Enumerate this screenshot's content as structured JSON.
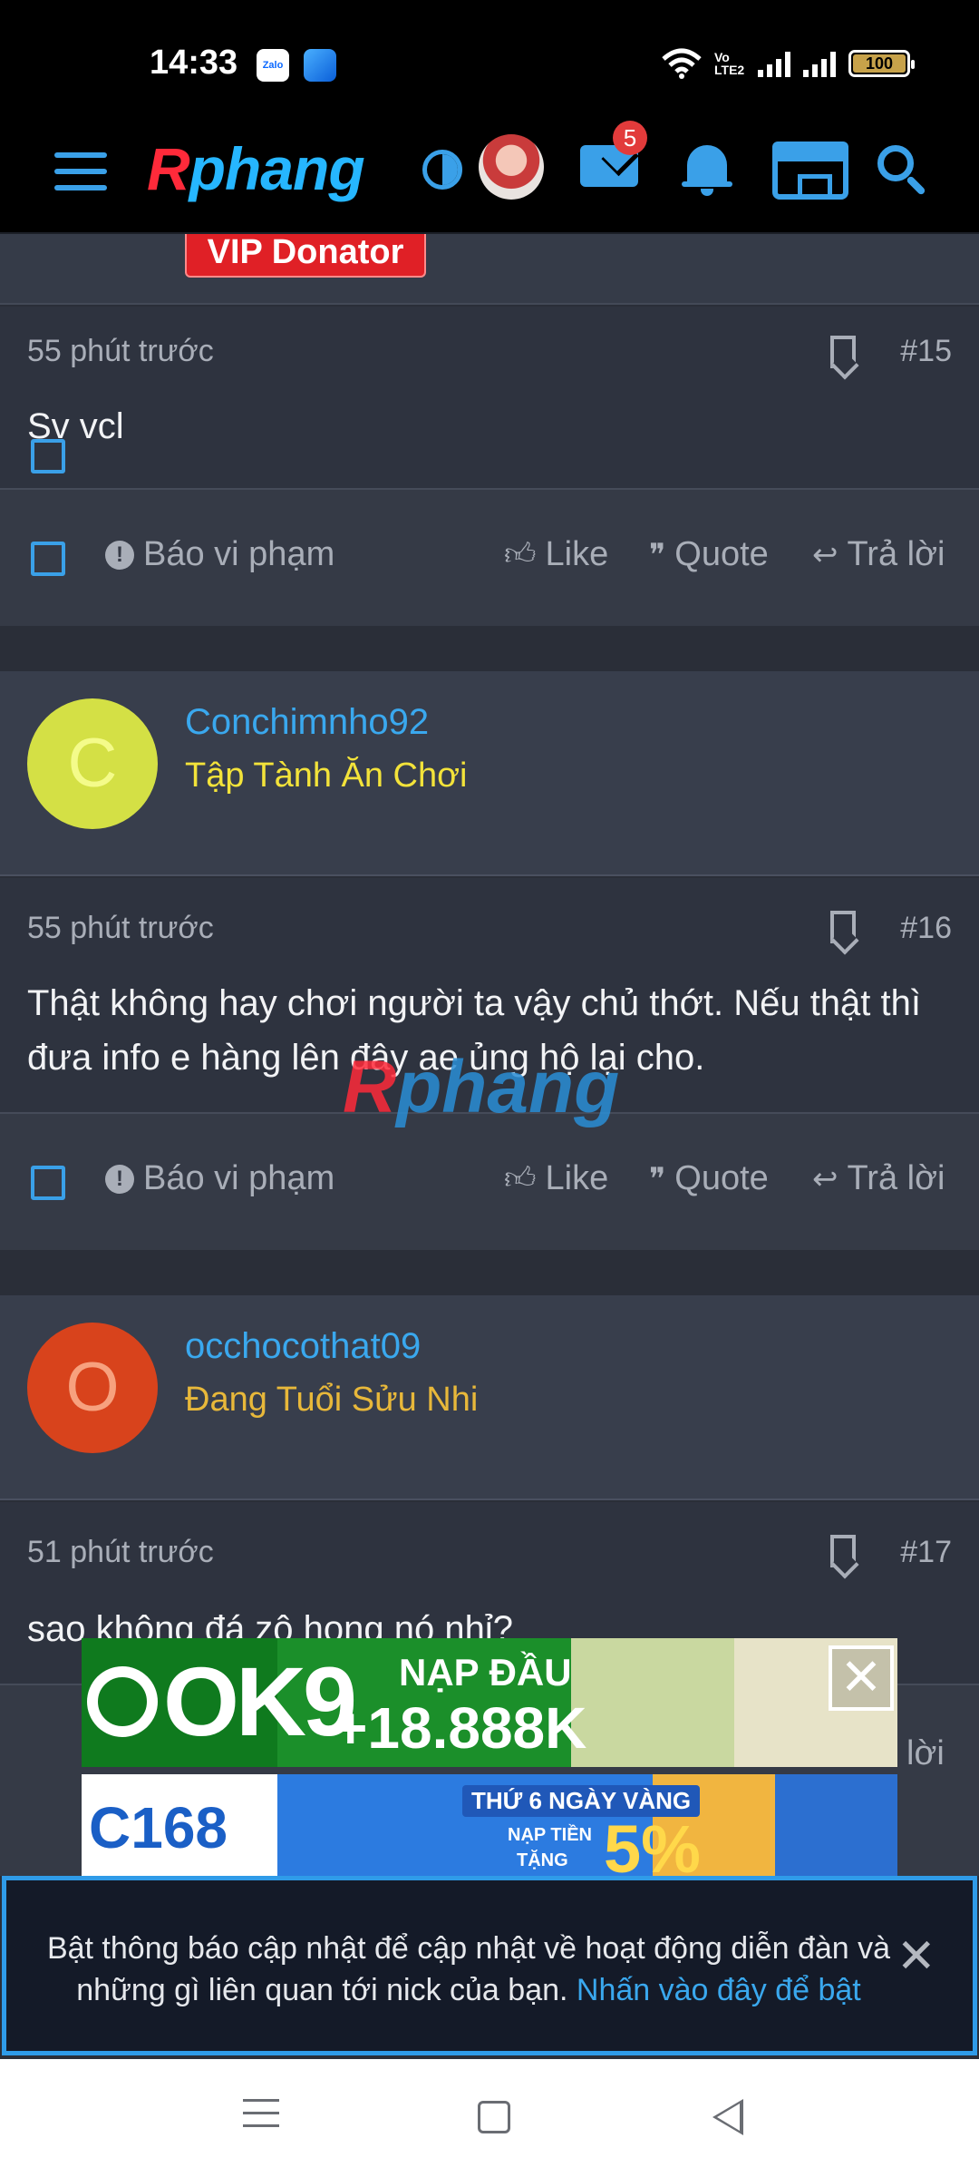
{
  "status_bar": {
    "time": "14:33",
    "zalo_label": "Zalo",
    "network_label": "Vo LTE2",
    "battery": "100"
  },
  "header": {
    "logo_r": "R",
    "logo_rest": "phang",
    "mail_badge": "5",
    "icons": [
      "menu-icon",
      "theme-toggle-icon",
      "avatar",
      "mail-icon",
      "bell-icon",
      "store-icon",
      "search-icon"
    ]
  },
  "vip_badge": "VIP Donator",
  "posts": [
    {
      "time": "55 phút trước",
      "number": "#15",
      "message": "Sv vcl",
      "actions": {
        "report": "Báo vi phạm",
        "like": "Like",
        "quote": "Quote",
        "reply": "Trả lời"
      }
    },
    {
      "user": {
        "initial": "C",
        "name": "Conchimnho92",
        "title": "Tập Tành Ăn Chơi",
        "avatar_color": "#d4e045",
        "initial_color": "#f4fb8a",
        "title_color": "#f3e33a"
      },
      "time": "55 phút trước",
      "number": "#16",
      "message": "Thật không hay chơi người ta vậy chủ thớt. Nếu thật thì đưa info e hàng lên đây ae ủng hộ lại cho.",
      "actions": {
        "report": "Báo vi phạm",
        "like": "Like",
        "quote": "Quote",
        "reply": "Trả lời"
      }
    },
    {
      "user": {
        "initial": "O",
        "name": "occhocothat09",
        "title": "Đang Tuổi Sửu Nhi",
        "avatar_color": "#d8431c",
        "initial_color": "#f7a17e",
        "title_color": "#e8b83a"
      },
      "time": "51 phút trước",
      "number": "#17",
      "message": "sao không đá zô họng nó nhỉ?",
      "actions": {
        "reply_partial": "lời"
      }
    }
  ],
  "ads": {
    "ok9": {
      "logo": "OK9",
      "line1": "NẠP ĐẦU",
      "line2": "+18.888K",
      "close": "✕"
    },
    "c168": {
      "logo": "C168",
      "line1": "THỨ 6 NGÀY VÀNG",
      "nap": "NẠP TIỀN",
      "tang": "TẶNG",
      "pct": "5%"
    }
  },
  "notification": {
    "text": "Bật thông báo cập nhật để cập nhật về hoạt động diễn đàn và những gì liên quan tới nick của bạn.",
    "link": "Nhấn vào đây để bật",
    "close": "✕"
  },
  "watermark": {
    "r": "R",
    "rest": "phang"
  },
  "colors": {
    "accent": "#3aa0e8",
    "background": "#2a2e38",
    "vip": "#e02026"
  }
}
